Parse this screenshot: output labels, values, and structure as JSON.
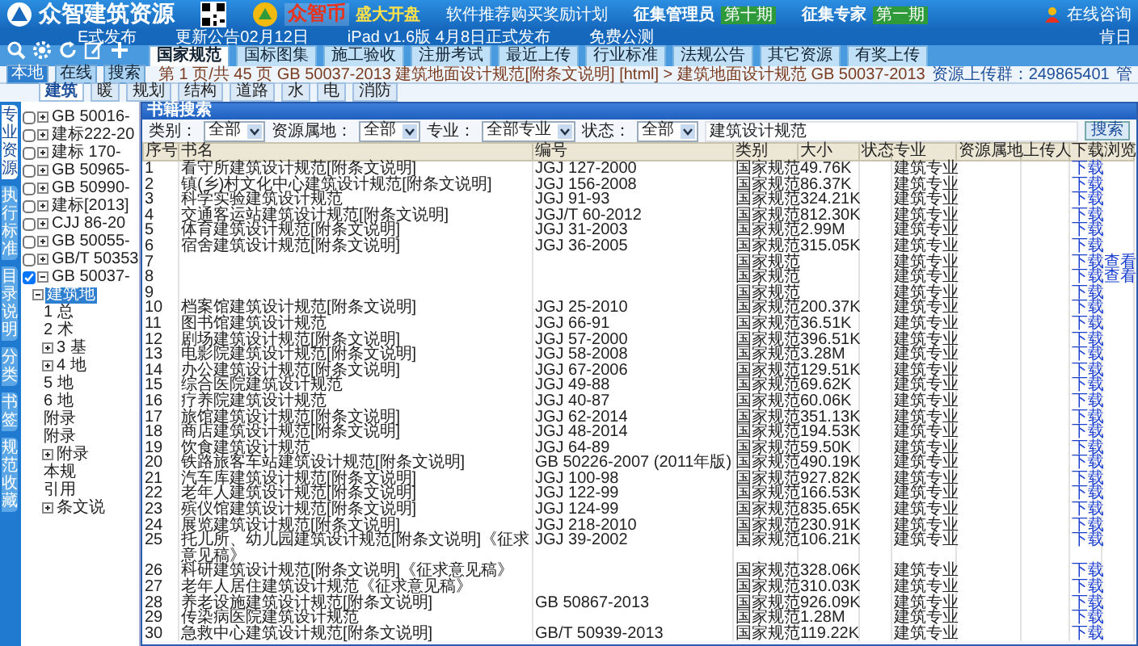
{
  "header": {
    "logo": "众智建筑资源",
    "promo_brand": "众智币",
    "promo_tag": "盛大开盘",
    "promo_text": "软件推荐购买奖励计划",
    "recruits": [
      {
        "label": "征集管理员",
        "badge": "第十期"
      },
      {
        "label": "征集专家",
        "badge": "第一期"
      }
    ],
    "consult": "在线咨询"
  },
  "news": [
    "E式发布",
    "更新公告02月12日",
    "iPad v1.6版 4月8日正式发布",
    "免费公测"
  ],
  "news_right": "肯日",
  "toolbar_tabs": [
    {
      "label": "国家规范",
      "selected": true
    },
    {
      "label": "国标图集",
      "selected": false
    },
    {
      "label": "施工验收",
      "selected": false
    },
    {
      "label": "注册考试",
      "selected": false
    },
    {
      "label": "最近上传",
      "selected": false
    },
    {
      "label": "行业标准",
      "selected": false
    },
    {
      "label": "法规公告",
      "selected": false
    },
    {
      "label": "其它资源",
      "selected": false
    },
    {
      "label": "有奖上传",
      "selected": false
    }
  ],
  "source_buttons": [
    {
      "label": "本地",
      "selected": true
    },
    {
      "label": "在线",
      "selected": false
    },
    {
      "label": "搜索",
      "selected": false
    }
  ],
  "breadcrumb": "第 1 页/共 45 页  GB 50037-2013 建筑地面设计规范[附条文说明] [html] > 建筑地面设计规范 GB 50037-2013",
  "upload_group": "资源上传群：249865401",
  "cut_label": "管",
  "side_tabs": [
    {
      "label": "专业资源",
      "selected": true
    },
    {
      "label": "执行标准",
      "selected": false
    },
    {
      "label": "目录说明",
      "selected": false
    },
    {
      "label": "分类",
      "selected": false
    },
    {
      "label": "书签",
      "selected": false
    },
    {
      "label": "规范收藏",
      "selected": false
    }
  ],
  "discipline_tabs": [
    {
      "label": "建筑",
      "selected": true
    },
    {
      "label": "暖",
      "selected": false
    },
    {
      "label": "规划",
      "selected": false
    },
    {
      "label": "结构",
      "selected": false
    },
    {
      "label": "道路",
      "selected": false
    },
    {
      "label": "水",
      "selected": false
    },
    {
      "label": "电",
      "selected": false
    },
    {
      "label": "消防",
      "selected": false
    }
  ],
  "tree": [
    {
      "label": "GB 50016-",
      "checked": false,
      "expanded": false,
      "selected": false
    },
    {
      "label": "建标222-20",
      "checked": false,
      "expanded": false,
      "selected": false
    },
    {
      "label": "建标 170-",
      "checked": false,
      "expanded": false,
      "selected": false
    },
    {
      "label": "GB 50965-",
      "checked": false,
      "expanded": false,
      "selected": false
    },
    {
      "label": "GB 50990-",
      "checked": false,
      "expanded": false,
      "selected": false
    },
    {
      "label": "建标[2013]",
      "checked": false,
      "expanded": false,
      "selected": false
    },
    {
      "label": "CJJ 86-20",
      "checked": false,
      "expanded": false,
      "selected": false
    },
    {
      "label": "GB 50055-",
      "checked": false,
      "expanded": false,
      "selected": false
    },
    {
      "label": "GB/T 50353",
      "checked": false,
      "expanded": false,
      "selected": false
    },
    {
      "label": "GB 50037-",
      "checked": true,
      "expanded": true,
      "selected": false,
      "children": [
        {
          "label": "建筑地",
          "expanded": true,
          "selected": true,
          "children": [
            {
              "label": "1 总",
              "selected": false
            },
            {
              "label": "2 术",
              "selected": false
            },
            {
              "label": "3 基",
              "expanded": false,
              "selected": false
            },
            {
              "label": "4 地",
              "expanded": false,
              "selected": false
            },
            {
              "label": "5 地",
              "selected": false
            },
            {
              "label": "6 地",
              "selected": false
            },
            {
              "label": "附录",
              "selected": false
            },
            {
              "label": "附录",
              "selected": false
            },
            {
              "label": "附录",
              "expanded": false,
              "selected": false
            },
            {
              "label": "本规",
              "selected": false
            },
            {
              "label": "引用",
              "selected": false
            },
            {
              "label": "条文说",
              "expanded": false,
              "selected": false
            }
          ]
        }
      ]
    }
  ],
  "dialog": {
    "title": "书籍搜索",
    "filters": [
      {
        "label": "类别：",
        "value": "全部"
      },
      {
        "label": "资源属地：",
        "value": "全部"
      },
      {
        "label": "专业：",
        "value": "全部专业"
      },
      {
        "label": "状态：",
        "value": "全部"
      }
    ],
    "keyword": "建筑设计规范",
    "search_button": "搜索",
    "columns": [
      "序号",
      "书名",
      "编号",
      "类别",
      "大小",
      "状态",
      "专业",
      "资源属地",
      "上传人",
      "下载",
      "浏览"
    ],
    "rows": [
      {
        "no": "1",
        "name": "看守所建筑设计规范[附条文说明]",
        "code": "JGJ 127-2000",
        "category": "国家规范",
        "size": "49.76K",
        "major": "建筑专业",
        "download": "下载"
      },
      {
        "no": "2",
        "name": "镇(乡)村文化中心建筑设计规范[附条文说明]",
        "code": "JGJ 156-2008",
        "category": "国家规范",
        "size": "86.37K",
        "major": "建筑专业",
        "download": "下载"
      },
      {
        "no": "3",
        "name": "科学实验建筑设计规范",
        "code": "JGJ 91-93",
        "category": "国家规范",
        "size": "324.21K",
        "major": "建筑专业",
        "download": "下载"
      },
      {
        "no": "4",
        "name": "交通客运站建筑设计规范[附条文说明]",
        "code": "JGJ/T 60-2012",
        "category": "国家规范",
        "size": "812.30K",
        "major": "建筑专业",
        "download": "下载"
      },
      {
        "no": "5",
        "name": "体育建筑设计规范[附条文说明]",
        "code": "JGJ 31-2003",
        "category": "国家规范",
        "size": "2.99M",
        "major": "建筑专业",
        "download": "下载"
      },
      {
        "no": "6",
        "name": "宿舍建筑设计规范[附条文说明]",
        "code": "JGJ 36-2005",
        "category": "国家规范",
        "size": "315.05K",
        "major": "建筑专业",
        "download": "下载"
      },
      {
        "no": "7",
        "category": "国家规范",
        "major": "建筑专业",
        "download": "下载",
        "view": "查看"
      },
      {
        "no": "8",
        "category": "国家规范",
        "major": "建筑专业",
        "download": "下载",
        "view": "查看"
      },
      {
        "no": "9",
        "category": "国家规范",
        "major": "建筑专业",
        "download": "下载"
      },
      {
        "no": "10",
        "name": "档案馆建筑设计规范[附条文说明]",
        "code": "JGJ 25-2010",
        "category": "国家规范",
        "size": "200.37K",
        "major": "建筑专业",
        "download": "下载"
      },
      {
        "no": "11",
        "name": "图书馆建筑设计规范",
        "code": "JGJ 66-91",
        "category": "国家规范",
        "size": "36.51K",
        "major": "建筑专业",
        "download": "下载"
      },
      {
        "no": "12",
        "name": "剧场建筑设计规范[附条文说明]",
        "code": "JGJ 57-2000",
        "category": "国家规范",
        "size": "396.51K",
        "major": "建筑专业",
        "download": "下载"
      },
      {
        "no": "13",
        "name": "电影院建筑设计规范[附条文说明]",
        "code": "JGJ 58-2008",
        "category": "国家规范",
        "size": "3.28M",
        "major": "建筑专业",
        "download": "下载"
      },
      {
        "no": "14",
        "name": "办公建筑设计规范[附条文说明]",
        "code": "JGJ 67-2006",
        "category": "国家规范",
        "size": "129.51K",
        "major": "建筑专业",
        "download": "下载"
      },
      {
        "no": "15",
        "name": "综合医院建筑设计规范",
        "code": "JGJ 49-88",
        "category": "国家规范",
        "size": "69.62K",
        "major": "建筑专业",
        "download": "下载"
      },
      {
        "no": "16",
        "name": "疗养院建筑设计规范",
        "code": "JGJ 40-87",
        "category": "国家规范",
        "size": "60.06K",
        "major": "建筑专业",
        "download": "下载"
      },
      {
        "no": "17",
        "name": "旅馆建筑设计规范[附条文说明]",
        "code": "JGJ 62-2014",
        "category": "国家规范",
        "size": "351.13K",
        "major": "建筑专业",
        "download": "下载"
      },
      {
        "no": "18",
        "name": "商店建筑设计规范[附条文说明]",
        "code": "JGJ 48-2014",
        "category": "国家规范",
        "size": "194.53K",
        "major": "建筑专业",
        "download": "下载"
      },
      {
        "no": "19",
        "name": "饮食建筑设计规范",
        "code": "JGJ 64-89",
        "category": "国家规范",
        "size": "59.50K",
        "major": "建筑专业",
        "download": "下载"
      },
      {
        "no": "20",
        "name": "铁路旅客车站建筑设计规范[附条文说明]",
        "code": "GB 50226-2007 (2011年版)",
        "category": "国家规范",
        "size": "490.19K",
        "major": "建筑专业",
        "download": "下载"
      },
      {
        "no": "21",
        "name": "汽车库建筑设计规范[附条文说明]",
        "code": "JGJ 100-98",
        "category": "国家规范",
        "size": "927.82K",
        "major": "建筑专业",
        "download": "下载"
      },
      {
        "no": "22",
        "name": "老年人建筑设计规范[附条文说明]",
        "code": "JGJ 122-99",
        "category": "国家规范",
        "size": "166.53K",
        "major": "建筑专业",
        "download": "下载"
      },
      {
        "no": "23",
        "name": "殡仪馆建筑设计规范[附条文说明]",
        "code": "JGJ 124-99",
        "category": "国家规范",
        "size": "835.65K",
        "major": "建筑专业",
        "download": "下载"
      },
      {
        "no": "24",
        "name": "展览建筑设计规范[附条文说明]",
        "code": "JGJ 218-2010",
        "category": "国家规范",
        "size": "230.91K",
        "major": "建筑专业",
        "download": "下载"
      },
      {
        "no": "25",
        "name": "托儿所、幼儿园建筑设计规范[附条文说明]《征求意见稿》",
        "code": "JGJ 39-2002",
        "category": "国家规范",
        "size": "106.21K",
        "major": "建筑专业",
        "download": "下载"
      },
      {
        "no": "26",
        "name": "科研建筑设计规范[附条文说明]《征求意见稿》",
        "category": "国家规范",
        "size": "328.06K",
        "major": "建筑专业",
        "download": "下载"
      },
      {
        "no": "27",
        "name": "老年人居住建筑设计规范《征求意见稿》",
        "category": "国家规范",
        "size": "310.03K",
        "major": "建筑专业",
        "download": "下载"
      },
      {
        "no": "28",
        "name": "养老设施建筑设计规范[附条文说明]",
        "code": "GB 50867-2013",
        "category": "国家规范",
        "size": "926.09K",
        "major": "建筑专业",
        "download": "下载"
      },
      {
        "no": "29",
        "name": "传染病医院建筑设计规范",
        "category": "国家规范",
        "size": "1.28M",
        "major": "建筑专业",
        "download": "下载"
      },
      {
        "no": "30",
        "name": "急救中心建筑设计规范[附条文说明]",
        "code": "GB/T 50939-2013",
        "category": "国家规范",
        "size": "119.22K",
        "major": "建筑专业",
        "download": "下载"
      }
    ]
  }
}
